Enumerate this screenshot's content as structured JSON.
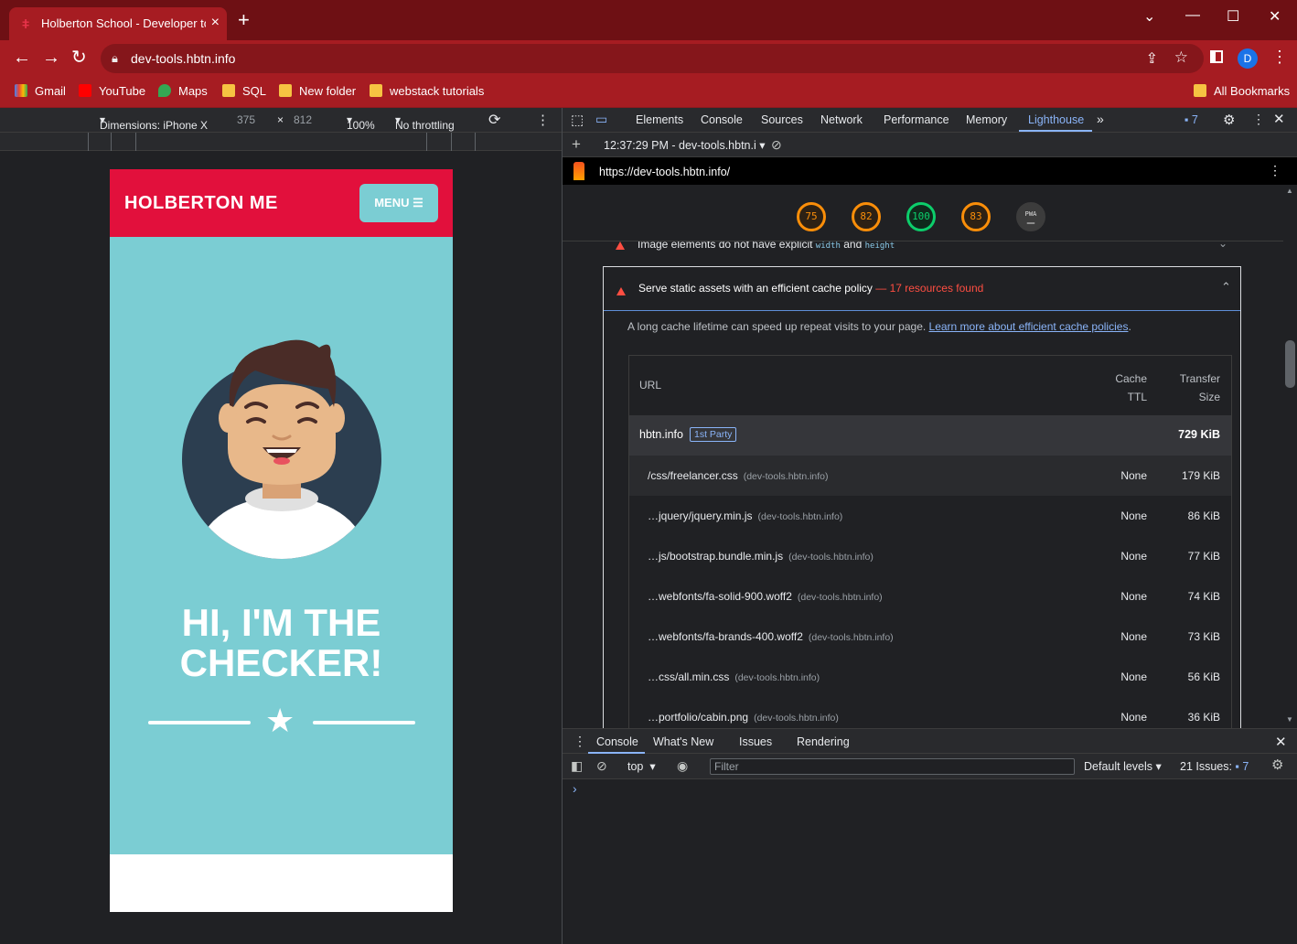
{
  "browser": {
    "tab_title": "Holberton School - Developer tools",
    "url": "dev-tools.hbtn.info",
    "profile_initial": "D",
    "bookmarks": [
      {
        "label": "Gmail",
        "icon": "gmail-icon"
      },
      {
        "label": "YouTube",
        "icon": "youtube-icon"
      },
      {
        "label": "Maps",
        "icon": "maps-icon"
      },
      {
        "label": "SQL",
        "icon": "folder-icon"
      },
      {
        "label": "New folder",
        "icon": "folder-icon"
      },
      {
        "label": "webstack tutorials",
        "icon": "folder-icon"
      }
    ],
    "all_bookmarks": "All Bookmarks"
  },
  "device_toolbar": {
    "dimensions_label": "Dimensions: iPhone X",
    "width": "375",
    "times": "×",
    "height": "812",
    "zoom": "100%",
    "throttling": "No throttling"
  },
  "page": {
    "brand": "HOLBERTON ME",
    "menu_label": "MENU",
    "hero_line1": "HI, I'M THE",
    "hero_line2": "CHECKER!"
  },
  "devtools": {
    "tabs": [
      "Elements",
      "Console",
      "Sources",
      "Network",
      "Performance",
      "Memory",
      "Lighthouse"
    ],
    "active_tab": "Lighthouse",
    "issues_count": "7",
    "report_label": "12:37:29 PM - dev-tools.hbtn.i",
    "report_url": "https://dev-tools.hbtn.info/",
    "scores": [
      {
        "value": "75",
        "color": "#fa8e09"
      },
      {
        "value": "82",
        "color": "#fa8e09"
      },
      {
        "value": "100",
        "color": "#0cce6b"
      },
      {
        "value": "83",
        "color": "#fa8e09"
      }
    ],
    "pwa_label": "PWA",
    "pwa_dash": "–",
    "prev_audit_text": "Image elements do not have explicit",
    "prev_audit_code1": "width",
    "prev_audit_and": "and",
    "prev_audit_code2": "height",
    "audit": {
      "title": "Serve static assets with an efficient cache policy",
      "count": " — 17 resources found",
      "desc": "A long cache lifetime can speed up repeat visits to your page. ",
      "link": "Learn more about efficient cache policies",
      "period": ".",
      "col_url": "URL",
      "col_ttl_1": "Cache",
      "col_ttl_2": "TTL",
      "col_size_1": "Transfer",
      "col_size_2": "Size",
      "party_host": "hbtn.info",
      "party_badge": "1st Party",
      "party_size": "729 KiB",
      "rows": [
        {
          "url": "/css/freelancer.css",
          "host": "(dev-tools.hbtn.info)",
          "ttl": "None",
          "size": "179 KiB"
        },
        {
          "url": "…jquery/jquery.min.js",
          "host": "(dev-tools.hbtn.info)",
          "ttl": "None",
          "size": "86 KiB"
        },
        {
          "url": "…js/bootstrap.bundle.min.js",
          "host": "(dev-tools.hbtn.info)",
          "ttl": "None",
          "size": "77 KiB"
        },
        {
          "url": "…webfonts/fa-solid-900.woff2",
          "host": "(dev-tools.hbtn.info)",
          "ttl": "None",
          "size": "74 KiB"
        },
        {
          "url": "…webfonts/fa-brands-400.woff2",
          "host": "(dev-tools.hbtn.info)",
          "ttl": "None",
          "size": "73 KiB"
        },
        {
          "url": "…css/all.min.css",
          "host": "(dev-tools.hbtn.info)",
          "ttl": "None",
          "size": "56 KiB"
        },
        {
          "url": "…portfolio/cabin.png",
          "host": "(dev-tools.hbtn.info)",
          "ttl": "None",
          "size": "36 KiB"
        }
      ]
    },
    "drawer_tabs": [
      "Console",
      "What's New",
      "Issues",
      "Rendering"
    ],
    "console": {
      "context": "top",
      "filter_placeholder": "Filter",
      "levels": "Default levels",
      "issues_label": "21 Issues:",
      "issues_count": "7",
      "prompt": "›"
    }
  }
}
